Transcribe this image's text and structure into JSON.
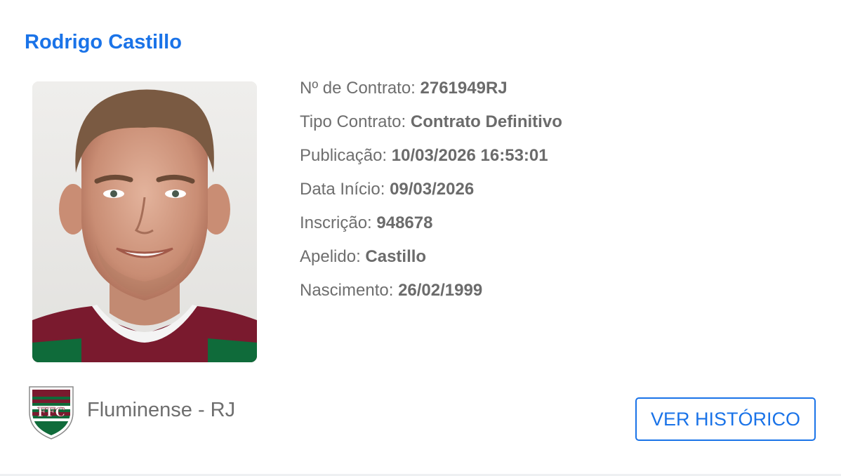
{
  "player": {
    "name": "Rodrigo Castillo"
  },
  "details": [
    {
      "label": "Nº de Contrato: ",
      "value": "2761949RJ"
    },
    {
      "label": "Tipo Contrato: ",
      "value": "Contrato Definitivo"
    },
    {
      "label": "Publicação: ",
      "value": "10/03/2026 16:53:01"
    },
    {
      "label": "Data Início: ",
      "value": "09/03/2026"
    },
    {
      "label": "Inscrição: ",
      "value": "948678"
    },
    {
      "label": "Apelido: ",
      "value": "Castillo"
    },
    {
      "label": "Nascimento: ",
      "value": "26/02/1999"
    }
  ],
  "club": {
    "name": "Fluminense - RJ",
    "crest_icon": "fluminense-crest-icon",
    "crest_colors": [
      "#7a1a2e",
      "#0f6b3a",
      "#ffffff"
    ],
    "crest_text": "FFC"
  },
  "actions": {
    "history_label": "VER HISTÓRICO"
  },
  "colors": {
    "accent": "#1a73e8",
    "text": "#6e6e6e"
  }
}
